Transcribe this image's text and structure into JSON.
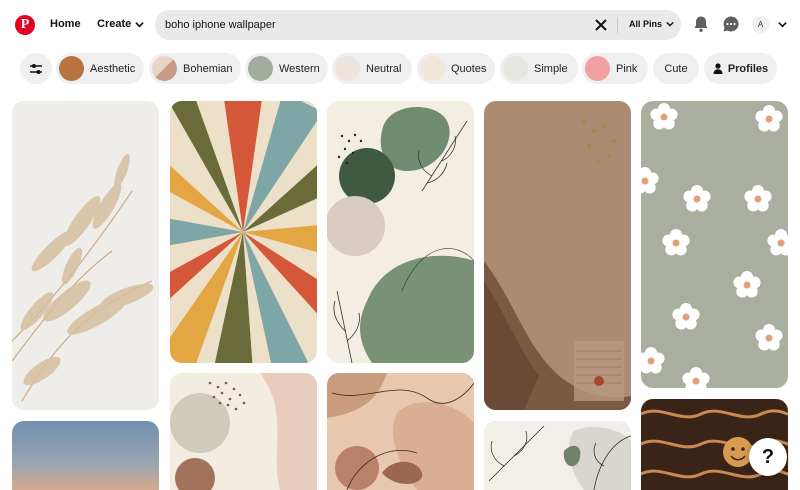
{
  "header": {
    "home_label": "Home",
    "create_label": "Create",
    "search": {
      "value": "boho iphone wallpaper",
      "scope_label": "All Pins"
    },
    "avatar_initial": "A"
  },
  "filters": {
    "chips": [
      {
        "label": "Aesthetic",
        "thumb_color": "#b8743f"
      },
      {
        "label": "Bohemian",
        "thumb_color": "#e8d5c8"
      },
      {
        "label": "Western",
        "thumb_color": "#a3ad9d"
      },
      {
        "label": "Neutral",
        "thumb_color": "#eee6dc"
      },
      {
        "label": "Quotes",
        "thumb_color": "#f1e7da"
      },
      {
        "label": "Simple",
        "thumb_color": "#e7e7e1"
      },
      {
        "label": "Pink",
        "thumb_color": "#f2a0a2"
      },
      {
        "label": "Cute"
      },
      {
        "label": "Profiles"
      }
    ]
  },
  "pins": [
    {
      "name": "pampas-grass-wallpaper",
      "icon": "pampas-grass"
    },
    {
      "name": "retro-sunburst-wallpaper",
      "icon": "sunburst"
    },
    {
      "name": "sage-abstract-shapes-wallpaper",
      "icon": "abstract-leaves"
    },
    {
      "name": "brown-torn-paper-wallpaper",
      "icon": "torn-paper"
    },
    {
      "name": "daisy-pattern-wallpaper",
      "icon": "daisy"
    },
    {
      "name": "dusk-sky-wallpaper",
      "icon": "sky"
    },
    {
      "name": "dotted-abstract-wallpaper",
      "icon": "dots"
    },
    {
      "name": "terracotta-blobs-wallpaper",
      "icon": "blobs"
    },
    {
      "name": "line-leaf-wallpaper",
      "icon": "leaf"
    },
    {
      "name": "wavy-smiley-wallpaper",
      "icon": "smiley"
    }
  ],
  "help_label": "?"
}
